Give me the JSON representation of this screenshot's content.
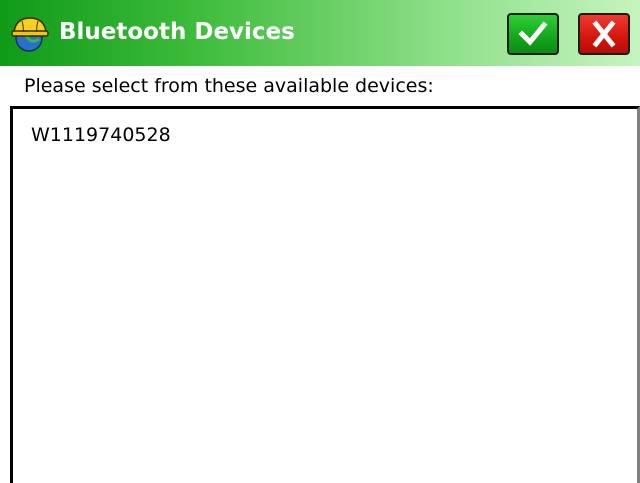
{
  "window": {
    "title": "Bluetooth Devices",
    "icon": "app-hardhat-globe-icon",
    "ok_icon": "checkmark-icon",
    "cancel_icon": "close-icon",
    "colors": {
      "titlebar_start": "#0f9a18",
      "titlebar_end": "#c6f4c0",
      "ok_button": "#14a51c",
      "cancel_button": "#d4150e"
    }
  },
  "main": {
    "prompt": "Please select from these available devices:",
    "devices": [
      {
        "label": "W1119740528"
      }
    ]
  }
}
